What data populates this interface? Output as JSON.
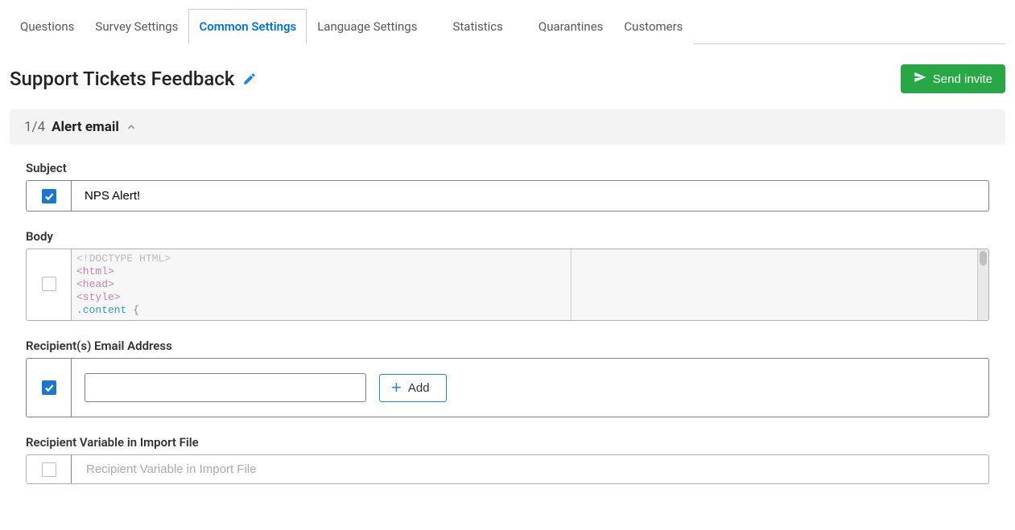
{
  "tabs": {
    "items": [
      {
        "label": "Questions"
      },
      {
        "label": "Survey Settings"
      },
      {
        "label": "Common Settings",
        "active": true
      },
      {
        "label": "Language Settings"
      },
      {
        "label": "Statistics"
      },
      {
        "label": "Quarantines"
      },
      {
        "label": "Customers"
      }
    ]
  },
  "header": {
    "title": "Support Tickets Feedback",
    "send_button": "Send invite"
  },
  "section": {
    "step": "1/4",
    "name": "Alert email"
  },
  "form": {
    "subject": {
      "label": "Subject",
      "value": "NPS Alert!",
      "enabled": true
    },
    "body": {
      "label": "Body",
      "enabled": false,
      "code": {
        "l1": "<!DOCTYPE HTML>",
        "l2": "<html>",
        "l3": "<head>",
        "l4": "<style>",
        "l5_sel": ".content",
        "l5_brace": " {"
      }
    },
    "recipients": {
      "label": "Recipient(s) Email Address",
      "value": "",
      "add_label": "Add",
      "enabled": true
    },
    "recipient_var": {
      "label": "Recipient Variable in Import File",
      "placeholder": "Recipient Variable in Import File",
      "enabled": false
    }
  }
}
